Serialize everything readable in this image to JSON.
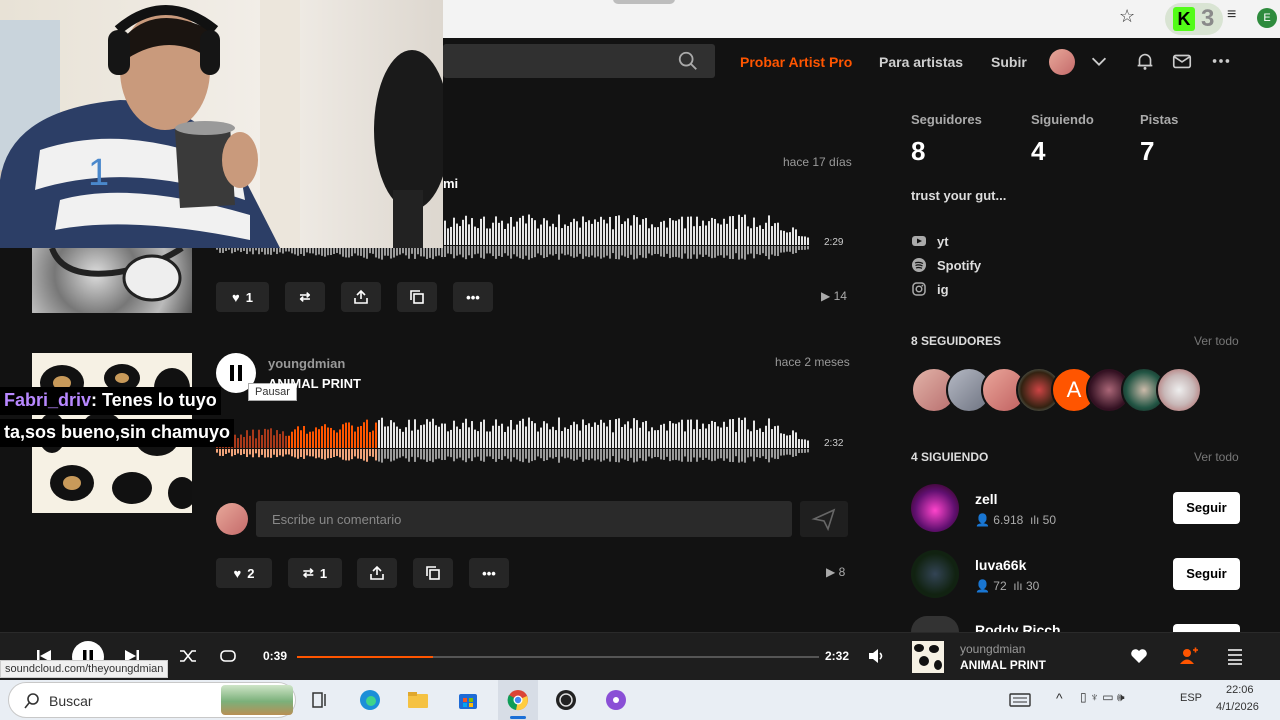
{
  "header": {
    "pro_link": "Probar Artist Pro",
    "artists_link": "Para artistas",
    "upload_link": "Subir"
  },
  "feed": {
    "track1": {
      "time_ago": "hace 17 días",
      "title_fragment": "mi",
      "duration": "2:29",
      "likes": "1",
      "plays": "14"
    },
    "track2": {
      "user": "youngdmian",
      "time_ago": "hace 2 meses",
      "title": "ANIMAL PRINT",
      "tooltip": "Pausar",
      "duration": "2:32",
      "comment_placeholder": "Escribe un comentario",
      "likes": "2",
      "reposts": "1",
      "plays": "8"
    }
  },
  "chat": {
    "username": "Fabri_driv",
    "line1": ": Tenes lo tuyo",
    "line2": "ta,sos bueno,sin chamuyo"
  },
  "sidebar": {
    "stats": [
      {
        "label": "Seguidores",
        "value": "8"
      },
      {
        "label": "Siguiendo",
        "value": "4"
      },
      {
        "label": "Pistas",
        "value": "7"
      }
    ],
    "bio": "trust your gut...",
    "links": [
      "yt",
      "Spotify",
      "ig"
    ],
    "followers_heading": "8 SEGUIDORES",
    "following_heading": "4 SIGUIENDO",
    "see_all": "Ver todo",
    "avatar_letter": "A",
    "following": [
      {
        "name": "zell",
        "followers": "6.918",
        "tracks": "50",
        "button": "Seguir"
      },
      {
        "name": "luva66k",
        "followers": "72",
        "tracks": "30",
        "button": "Seguir"
      },
      {
        "name": "Roddy Ricch"
      }
    ]
  },
  "player": {
    "elapsed": "0:39",
    "total": "2:32",
    "progress": 0.26,
    "artist": "youngdmian",
    "title": "ANIMAL PRINT"
  },
  "status_url": "soundcloud.com/theyoungdmian",
  "taskbar": {
    "search_placeholder": "Buscar",
    "lang": "ESP",
    "time": "22:06",
    "date": "4/1/2026"
  },
  "browser": {
    "kick_count": "3",
    "profile_letter": "E"
  },
  "colors": {
    "accent": "#ff5500",
    "background": "#121212"
  }
}
